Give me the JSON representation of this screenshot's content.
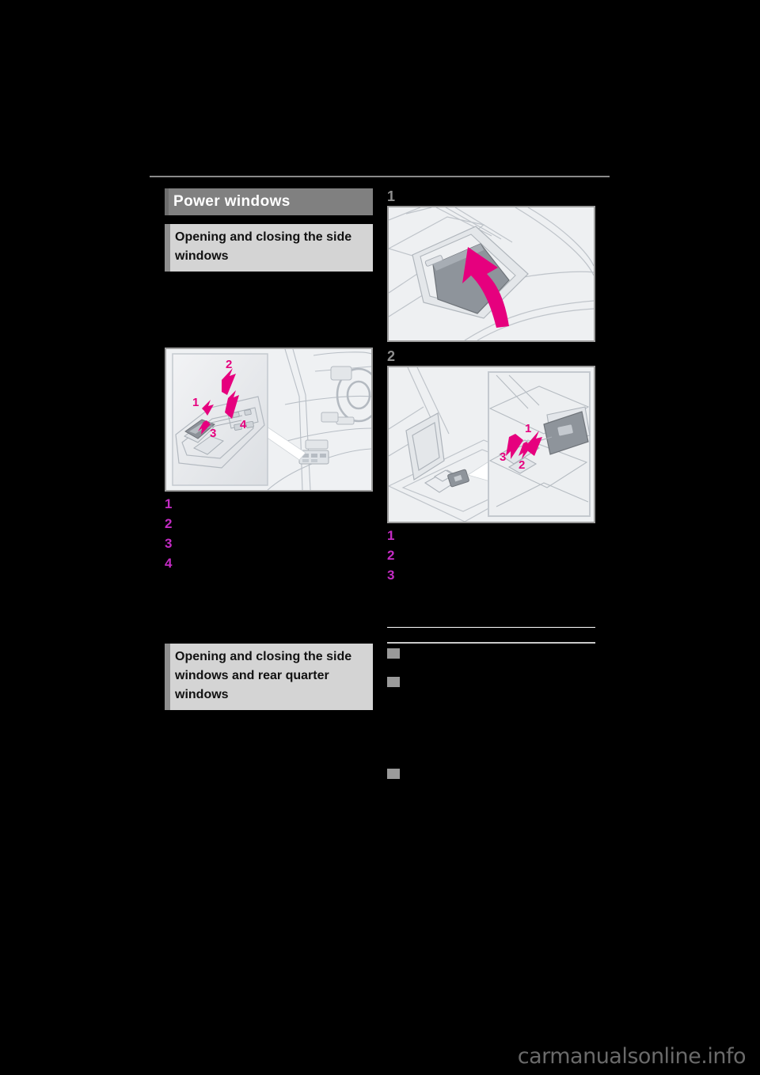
{
  "document": {
    "type": "vehicle-owners-manual-page",
    "background_color": "#000000",
    "watermark": "carmanualsonline.info"
  },
  "left_column": {
    "section_heading": "Power windows",
    "subsection_1_heading": "Opening and closing the side windows",
    "figure_1": {
      "caption_markers": [
        "1",
        "2",
        "3",
        "4"
      ],
      "description": "Driver door armrest power window switch panel with callouts, inset over dashboard view"
    },
    "steps": [
      {
        "num": "1",
        "text": ""
      },
      {
        "num": "2",
        "text": ""
      },
      {
        "num": "3",
        "text": ""
      },
      {
        "num": "4",
        "text": ""
      }
    ],
    "subsection_2_heading": "Opening and closing the side windows and rear quarter windows"
  },
  "right_column": {
    "step_marker_1": "1",
    "figure_1": {
      "description": "Console box lid being opened, pink curved arrow upward"
    },
    "step_marker_2": "2",
    "figure_2": {
      "caption_markers": [
        "1",
        "2",
        "3"
      ],
      "description": "Rear console window switch with magnified inset and callouts"
    },
    "steps": [
      {
        "num": "1",
        "text": ""
      },
      {
        "num": "2",
        "text": ""
      },
      {
        "num": "3",
        "text": ""
      }
    ],
    "section_title": "",
    "bullet_1_title": "",
    "bullet_2_title": ""
  },
  "colors": {
    "heading_bar": "#808080",
    "subheading_bar": "#d4d4d4",
    "subheading_accent": "#8f8f8f",
    "number_marker": "#c32bc3",
    "figure_border": "#9d9d9d",
    "figure_bg": "#eceef0",
    "arrow_pink": "#e6007e",
    "watermark": "#6a6a6a"
  }
}
